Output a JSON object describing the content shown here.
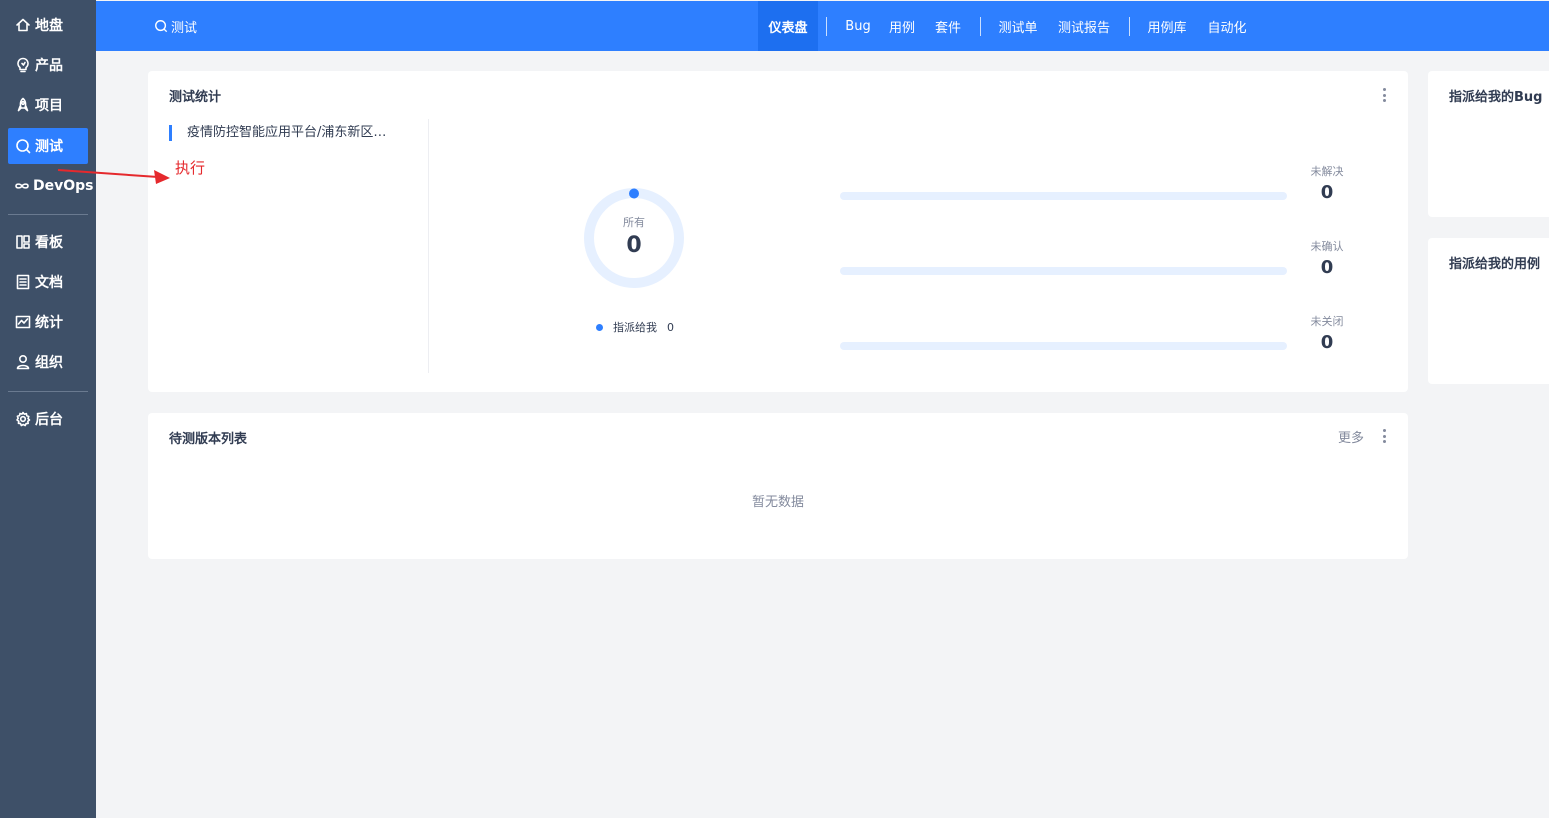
{
  "sidebar": {
    "items": [
      {
        "label": "地盘",
        "icon": "home-icon"
      },
      {
        "label": "产品",
        "icon": "bulb-icon"
      },
      {
        "label": "项目",
        "icon": "rocket-icon"
      },
      {
        "label": "测试",
        "icon": "search-icon"
      },
      {
        "label": "DevOps",
        "icon": "infinity-icon"
      },
      {
        "label": "看板",
        "icon": "kanban-icon"
      },
      {
        "label": "文档",
        "icon": "document-icon"
      },
      {
        "label": "统计",
        "icon": "chart-icon"
      },
      {
        "label": "组织",
        "icon": "user-icon"
      },
      {
        "label": "后台",
        "icon": "gear-icon"
      }
    ],
    "active": "测试"
  },
  "header": {
    "title": "测试",
    "tabs": [
      "仪表盘",
      "Bug",
      "用例",
      "套件",
      "测试单",
      "测试报告",
      "用例库",
      "自动化"
    ],
    "active_tab": "仪表盘"
  },
  "test_stats": {
    "title": "测试统计",
    "project": "疫情防控智能应用平台/浦东新区疫情防控智能应用平台",
    "annotation": "执行",
    "ring_label": "所有",
    "ring_value": "0",
    "legend_label": "指派给我",
    "legend_value": "0",
    "stats": [
      {
        "label": "未解决",
        "value": "0"
      },
      {
        "label": "未确认",
        "value": "0"
      },
      {
        "label": "未关闭",
        "value": "0"
      }
    ]
  },
  "pending_builds": {
    "title": "待测版本列表",
    "more": "更多",
    "empty": "暂无数据"
  },
  "right_cards": {
    "bug_title": "指派给我的Bug",
    "case_title": "指派给我的用例"
  },
  "colors": {
    "primary": "#2e7fff",
    "sidebar": "#3e5068",
    "annotation": "#e5292d"
  }
}
